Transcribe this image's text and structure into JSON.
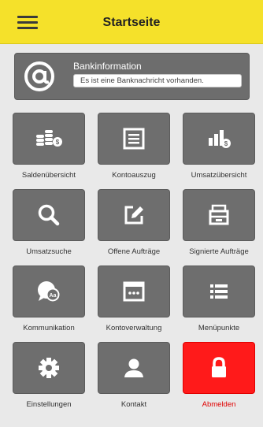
{
  "header": {
    "title": "Startseite",
    "menu_icon": "hamburger-menu-icon",
    "background": "#f5e12a"
  },
  "bank_info": {
    "icon": "at-sign-icon",
    "title": "Bankinformation",
    "message": "Es ist eine Banknachricht vorhanden."
  },
  "tiles": [
    {
      "label": "Saldenübersicht",
      "icon": "coins-stack-icon"
    },
    {
      "label": "Kontoauszug",
      "icon": "document-list-icon"
    },
    {
      "label": "Umsatzübersicht",
      "icon": "bar-chart-coin-icon"
    },
    {
      "label": "Umsatzsuche",
      "icon": "magnifier-icon"
    },
    {
      "label": "Offene Aufträge",
      "icon": "edit-document-icon"
    },
    {
      "label": "Signierte Aufträge",
      "icon": "archive-drawer-icon"
    },
    {
      "label": "Kommunikation",
      "icon": "chat-globe-icon"
    },
    {
      "label": "Kontoverwaltung",
      "icon": "window-dots-icon"
    },
    {
      "label": "Menüpunkte",
      "icon": "list-icon"
    },
    {
      "label": "Einstellungen",
      "icon": "gear-icon"
    },
    {
      "label": "Kontakt",
      "icon": "person-icon"
    },
    {
      "label": "Abmelden",
      "icon": "lock-icon",
      "accent": "#ff1a1a"
    }
  ]
}
